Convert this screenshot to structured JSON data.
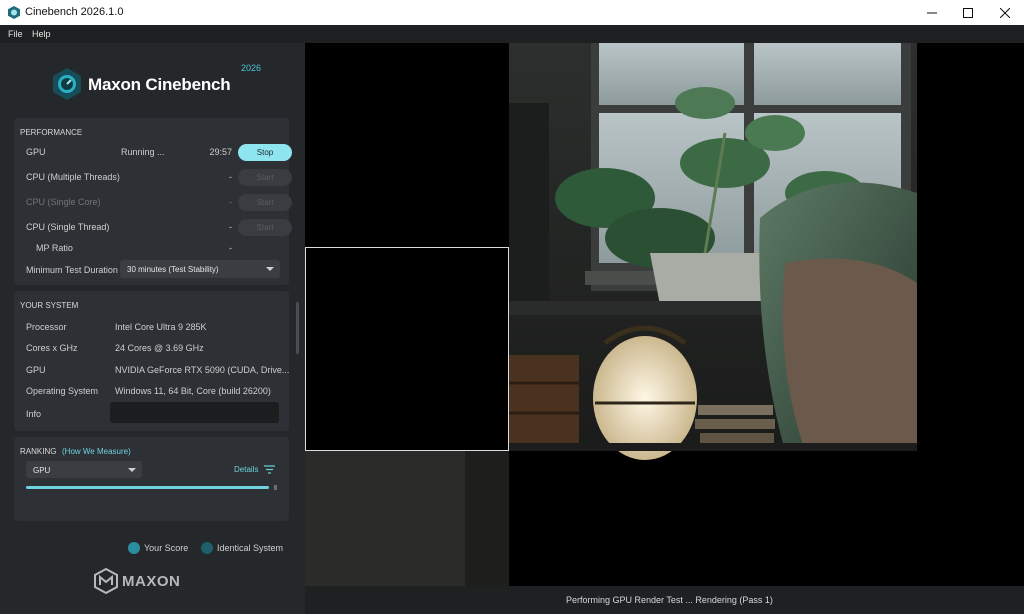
{
  "window": {
    "title": "Cinebench 2026.1.0"
  },
  "menu": {
    "items": [
      "File",
      "Help"
    ]
  },
  "brand": {
    "name": "Maxon Cinebench",
    "year": "2026",
    "accent": "#4fc3d6",
    "footer_word": "MAXON"
  },
  "performance": {
    "heading": "PERFORMANCE",
    "tests": [
      {
        "label": "GPU",
        "status": "Running ...",
        "time": "29:57",
        "button": "Stop",
        "enabled": true
      },
      {
        "label": "CPU (Multiple Threads)",
        "status": "",
        "time": "-",
        "button": "Start",
        "enabled": true
      },
      {
        "label": "CPU (Single Core)",
        "status": "",
        "time": "-",
        "button": "Start",
        "enabled": false
      },
      {
        "label": "CPU (Single Thread)",
        "status": "",
        "time": "-",
        "button": "Start",
        "enabled": true
      }
    ],
    "mp_ratio": {
      "label": "MP Ratio",
      "value": "-"
    },
    "min_duration": {
      "label": "Minimum Test Duration",
      "value": "30 minutes (Test Stability)"
    }
  },
  "system": {
    "heading": "YOUR SYSTEM",
    "rows": [
      {
        "key": "Processor",
        "value": "Intel Core Ultra 9 285K"
      },
      {
        "key": "Cores x GHz",
        "value": "24 Cores @ 3.69 GHz"
      },
      {
        "key": "GPU",
        "value": "NVIDIA GeForce RTX 5090 (CUDA, Drive..."
      },
      {
        "key": "Operating System",
        "value": "Windows 11, 64 Bit, Core (build 26200)"
      },
      {
        "key": "Info",
        "value": ""
      }
    ]
  },
  "ranking": {
    "heading": "RANKING",
    "link": "(How We Measure)",
    "selected": "GPU",
    "details": "Details",
    "legend": [
      {
        "label": "Your Score",
        "color": "#2b8ea0"
      },
      {
        "label": "Identical System",
        "color": "#1e5f6b"
      }
    ]
  },
  "status": {
    "text": "Performing GPU Render Test ... Rendering (Pass 1)"
  }
}
